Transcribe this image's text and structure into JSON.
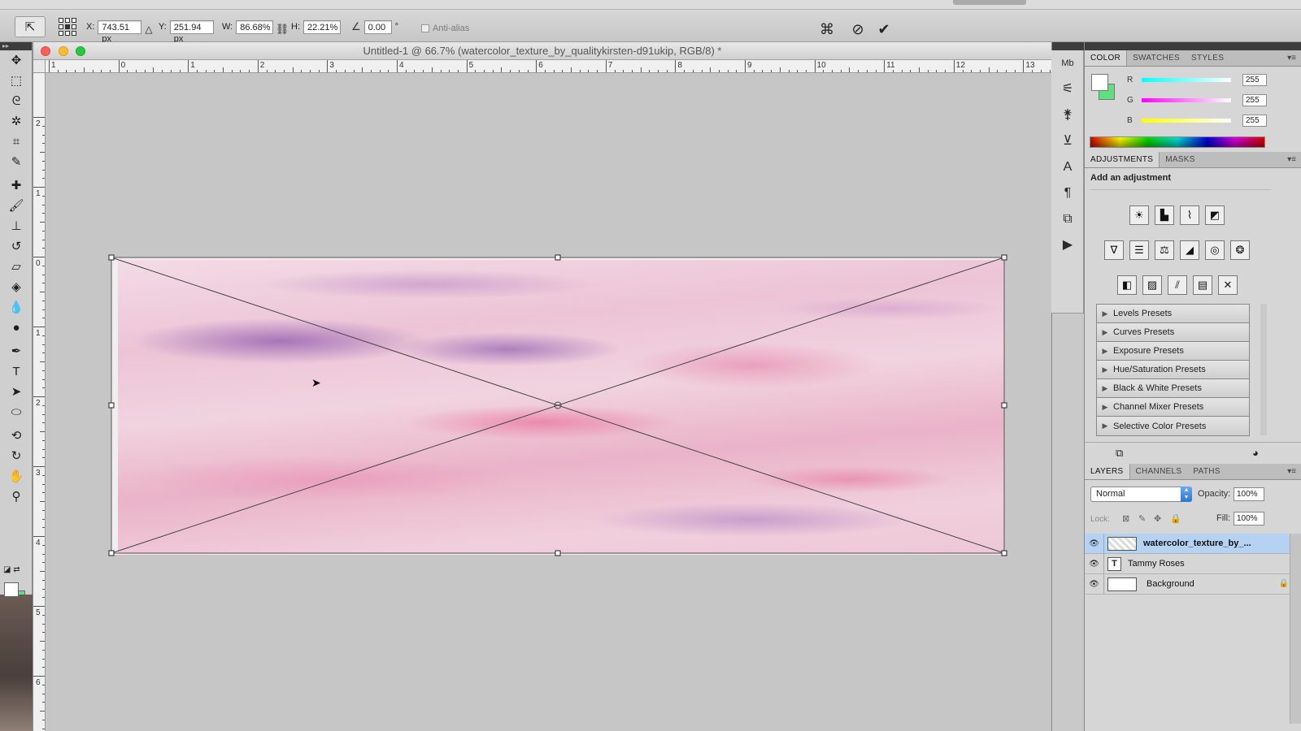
{
  "options_bar": {
    "x_label": "X:",
    "x_value": "743.51 px",
    "y_label": "Y:",
    "y_value": "251.94 px",
    "w_label": "W:",
    "w_value": "86.68%",
    "h_label": "H:",
    "h_value": "22.21%",
    "angle_value": "0.00",
    "angle_unit": "°",
    "anti_alias_label": "Anti-alias"
  },
  "document": {
    "title": "Untitled-1 @ 66.7% (watercolor_texture_by_qualitykirsten-d91ukip, RGB/8) *",
    "ruler_h_labels": [
      "1",
      "0",
      "1",
      "2",
      "3",
      "4",
      "5",
      "6",
      "7",
      "8",
      "9",
      "10",
      "11",
      "12",
      "13"
    ],
    "ruler_v_labels": [
      "2",
      "1",
      "0",
      "1",
      "2",
      "3",
      "4",
      "5",
      "6"
    ]
  },
  "color_panel": {
    "tabs": [
      "COLOR",
      "SWATCHES",
      "STYLES"
    ],
    "channels": [
      {
        "label": "R",
        "value": "255"
      },
      {
        "label": "G",
        "value": "255"
      },
      {
        "label": "B",
        "value": "255"
      }
    ],
    "foreground": "#ffffff",
    "background": "#5ee07e"
  },
  "adjustments_panel": {
    "tabs": [
      "ADJUSTMENTS",
      "MASKS"
    ],
    "heading": "Add an adjustment",
    "icons_row1": [
      "brightness-contrast-icon",
      "levels-icon",
      "curves-icon",
      "exposure-icon"
    ],
    "icons_row2": [
      "vibrance-icon",
      "hue-saturation-icon",
      "color-balance-icon",
      "black-white-icon",
      "photo-filter-icon",
      "channel-mixer-icon"
    ],
    "icons_row3": [
      "invert-icon",
      "posterize-icon",
      "threshold-icon",
      "gradient-map-icon",
      "selective-color-icon"
    ],
    "presets": [
      "Levels Presets",
      "Curves Presets",
      "Exposure Presets",
      "Hue/Saturation Presets",
      "Black & White Presets",
      "Channel Mixer Presets",
      "Selective Color Presets"
    ]
  },
  "layers_panel": {
    "tabs": [
      "LAYERS",
      "CHANNELS",
      "PATHS"
    ],
    "blend_mode": "Normal",
    "opacity_label": "Opacity:",
    "opacity_value": "100%",
    "lock_label": "Lock:",
    "fill_label": "Fill:",
    "fill_value": "100%",
    "layers": [
      {
        "name": "watercolor_texture_by_...",
        "type": "image",
        "selected": true
      },
      {
        "name": "Tammy Roses",
        "type": "text",
        "selected": false
      },
      {
        "name": "Background",
        "type": "background",
        "selected": false,
        "locked": true
      }
    ]
  }
}
